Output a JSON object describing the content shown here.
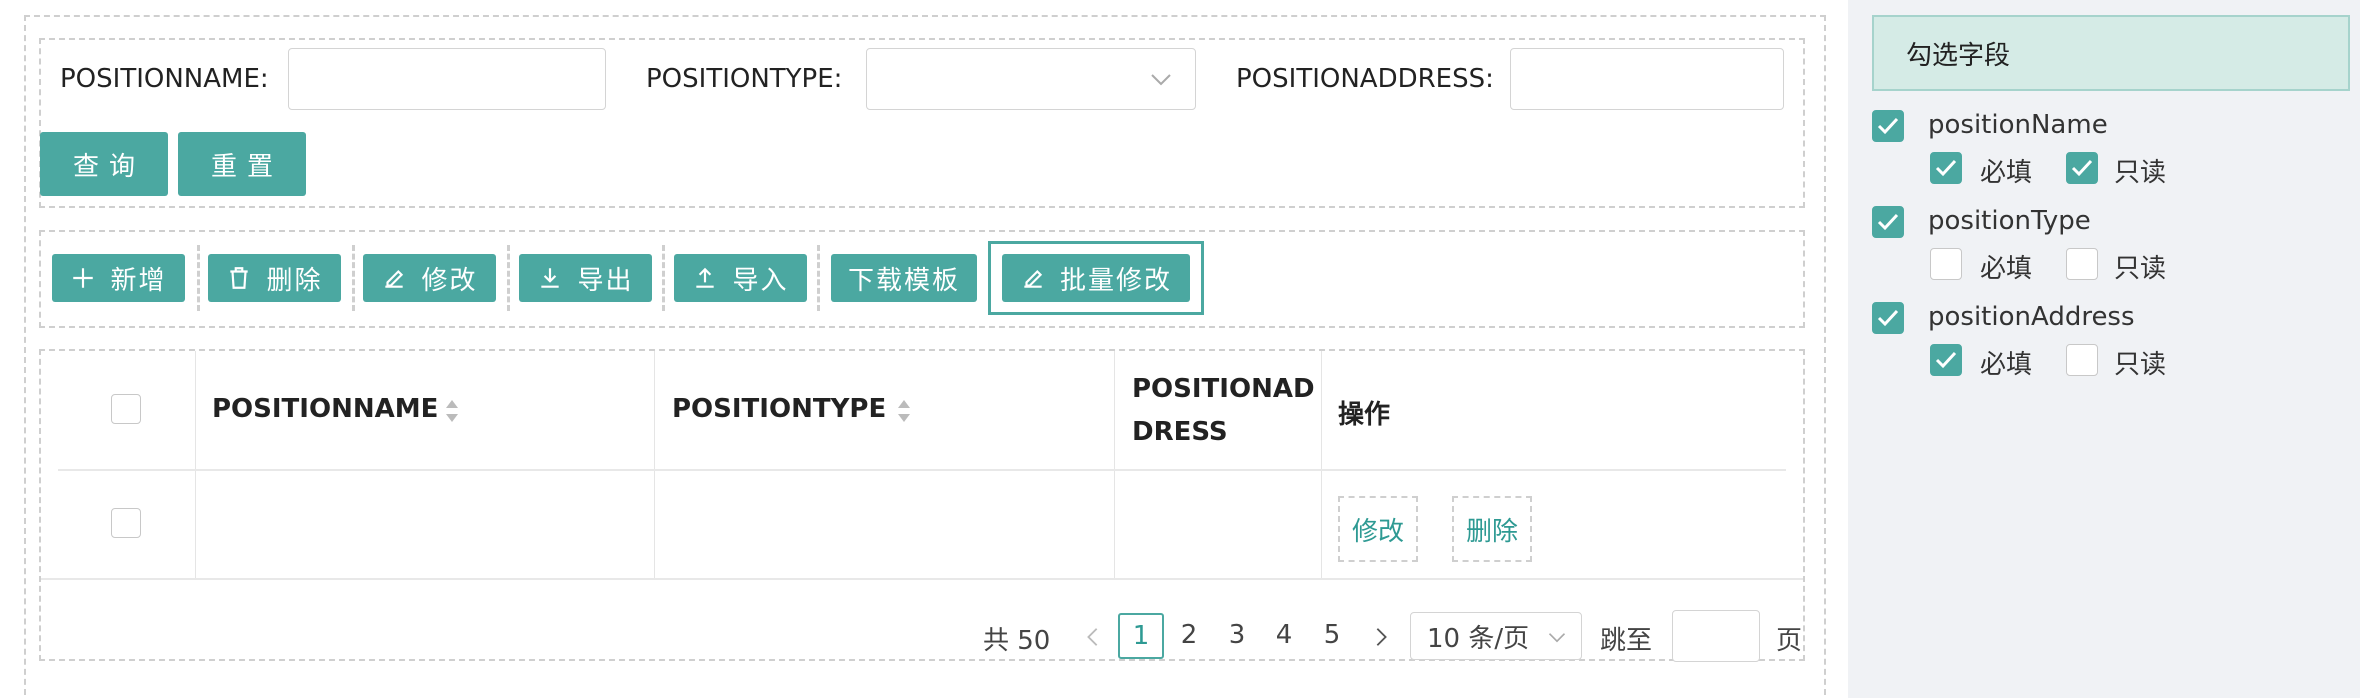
{
  "search": {
    "position_name_label": "POSITIONNAME:",
    "position_name_value": "",
    "position_type_label": "POSITIONTYPE:",
    "position_type_value": "",
    "position_address_label": "POSITIONADDRESS:",
    "position_address_value": "",
    "query_button": "查询",
    "reset_button": "重置"
  },
  "toolbar": {
    "add": "新增",
    "delete": "删除",
    "edit": "修改",
    "export": "导出",
    "import": "导入",
    "download_template": "下载模板",
    "batch_edit": "批量修改"
  },
  "table": {
    "columns": [
      "POSITIONNAME",
      "POSITIONTYPE",
      "POSITIONAD",
      "DRESS",
      "操作"
    ],
    "rows": [
      {
        "position_name": "",
        "position_type": "",
        "position_address": "",
        "actions": [
          "修改",
          "删除"
        ]
      }
    ]
  },
  "pagination": {
    "total": "共 50",
    "pages": [
      "1",
      "2",
      "3",
      "4",
      "5"
    ],
    "current": "1",
    "page_size": "10 条/页",
    "jump_label": "跳至",
    "page_suffix": "页"
  },
  "side_panel": {
    "title": "勾选字段",
    "required_label": "必填",
    "readonly_label": "只读",
    "fields": [
      {
        "name": "positionName",
        "checked": true,
        "required": true,
        "readonly": true
      },
      {
        "name": "positionType",
        "checked": true,
        "required": false,
        "readonly": false
      },
      {
        "name": "positionAddress",
        "checked": true,
        "required": true,
        "readonly": false
      }
    ]
  },
  "colors": {
    "accent": "#4ba8a1",
    "link": "#2e9a93",
    "side_header_bg": "#d5ebe6"
  },
  "icons": [
    "plus-icon",
    "trash-icon",
    "pencil-icon",
    "download-icon",
    "upload-icon",
    "chevron-down-icon",
    "sort-icon",
    "check-icon",
    "chevron-left-icon",
    "chevron-right-icon"
  ]
}
